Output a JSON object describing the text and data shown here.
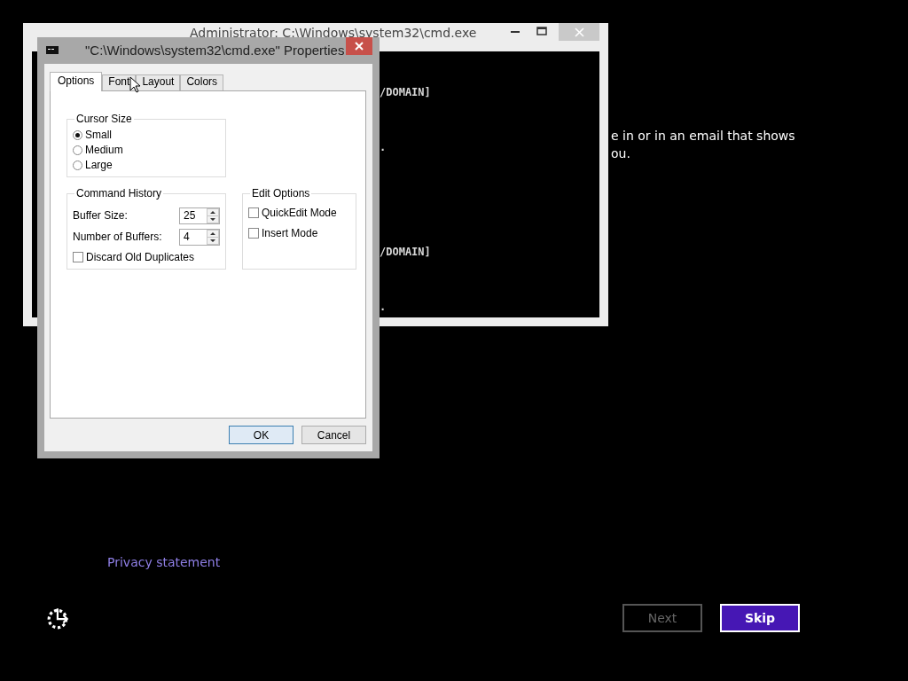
{
  "setup_screen": {
    "message_lines": [
      "e in or in an email that shows",
      "ou."
    ],
    "privacy_link": "Privacy statement",
    "buttons": [
      {
        "label": "Next",
        "disabled": true
      },
      {
        "label": "Skip",
        "disabled": false
      }
    ]
  },
  "console_window": {
    "title": "Administrator: C:\\Windows\\system32\\cmd.exe",
    "lines": [
      "/DOMAIN]",
      ".",
      "/DOMAIN]",
      "."
    ]
  },
  "properties_dialog": {
    "title": "\"C:\\Windows\\system32\\cmd.exe\" Properties",
    "tabs": [
      {
        "label": "Options",
        "selected": true
      },
      {
        "label": "Font",
        "selected": false
      },
      {
        "label": "Layout",
        "selected": false
      },
      {
        "label": "Colors",
        "selected": false
      }
    ],
    "cursor_size": {
      "title": "Cursor Size",
      "options": [
        {
          "label": "Small",
          "selected": true
        },
        {
          "label": "Medium",
          "selected": false
        },
        {
          "label": "Large",
          "selected": false
        }
      ]
    },
    "command_history": {
      "title": "Command History",
      "fields": [
        {
          "label": "Buffer Size:",
          "value": "25"
        },
        {
          "label": "Number of Buffers:",
          "value": "4"
        }
      ],
      "checkbox": {
        "label": "Discard Old Duplicates",
        "checked": false
      }
    },
    "edit_options": {
      "title": "Edit Options",
      "checkboxes": [
        {
          "label": "QuickEdit Mode",
          "checked": false
        },
        {
          "label": "Insert Mode",
          "checked": false
        }
      ]
    },
    "buttons": [
      {
        "label": "OK",
        "default": true
      },
      {
        "label": "Cancel",
        "default": false
      }
    ]
  }
}
